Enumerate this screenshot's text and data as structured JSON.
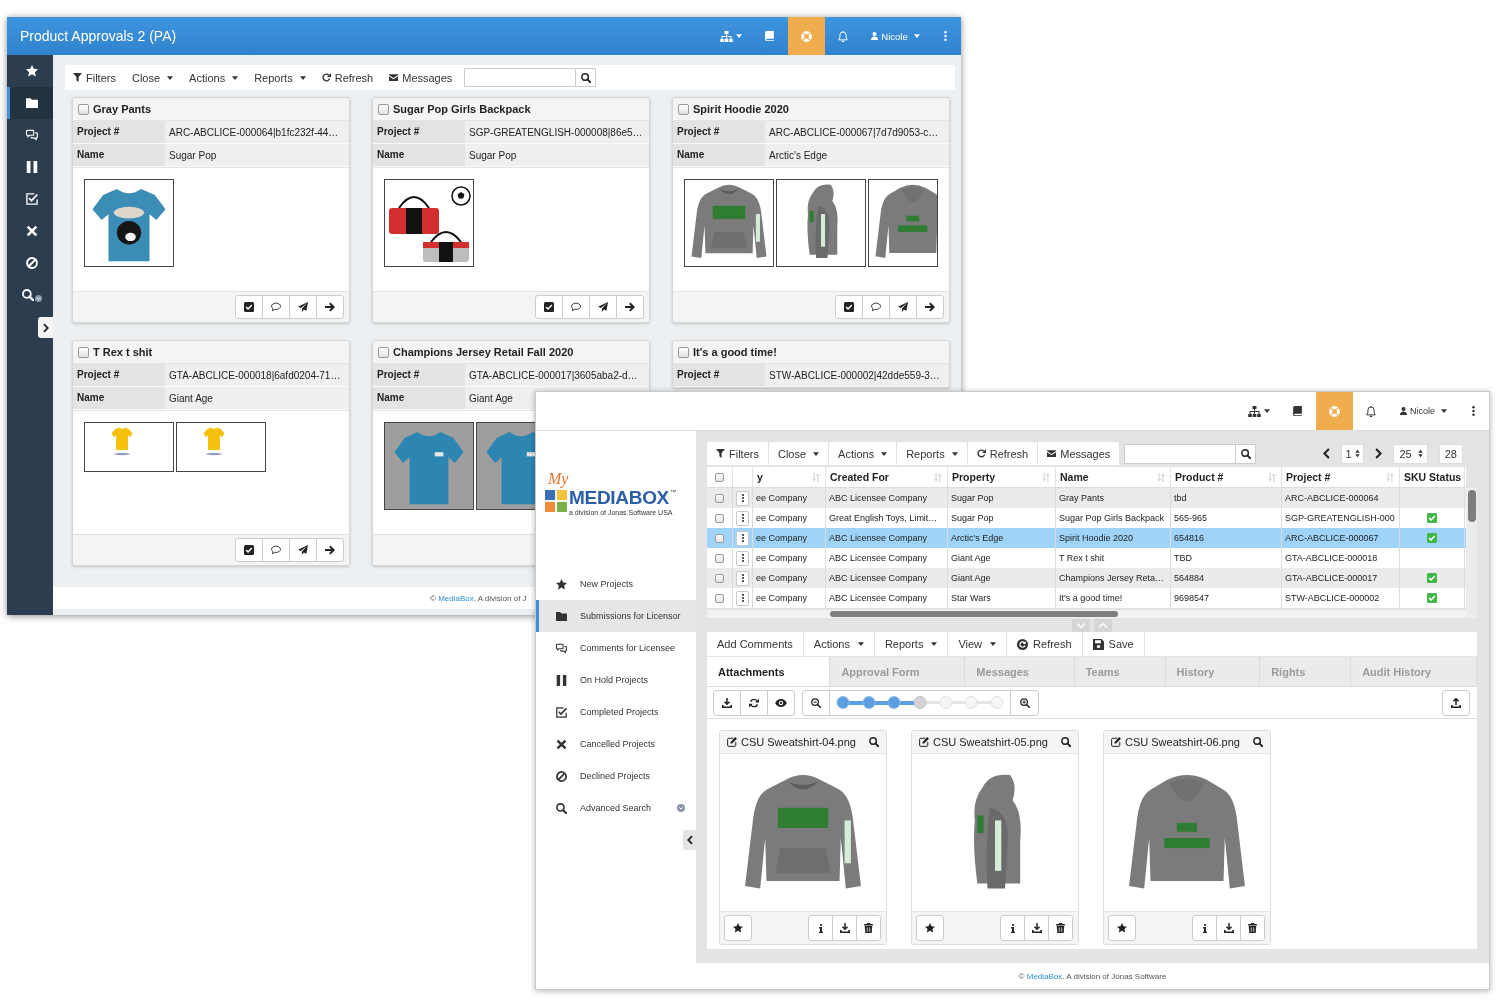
{
  "back_window": {
    "title": "Product Approvals 2 (PA)",
    "user": "Nicole",
    "sidebar": [
      {
        "selected": false
      },
      {
        "selected": true
      },
      {
        "selected": false
      },
      {
        "selected": false
      },
      {
        "selected": false
      },
      {
        "selected": false
      },
      {
        "selected": false
      },
      {
        "selected": false
      }
    ],
    "toolbar": [
      {
        "label": "Filters",
        "kind": "button"
      },
      {
        "label": "Close",
        "kind": "dropdown"
      },
      {
        "label": "Actions",
        "kind": "dropdown"
      },
      {
        "label": "Reports",
        "kind": "dropdown"
      },
      {
        "label": "Refresh",
        "kind": "button"
      },
      {
        "label": "Messages",
        "kind": "button"
      }
    ],
    "cards": [
      {
        "title": "Gray Pants",
        "checked": false,
        "fields": [
          {
            "label": "Project #",
            "value": "ARC-ABCLICE-000064|b1fc232f-44…"
          },
          {
            "label": "Name",
            "value": "Sugar Pop"
          }
        ],
        "images": [
          {
            "kind": "tee-print"
          }
        ],
        "action_buttons": true
      },
      {
        "title": "Sugar Pop Girls Backpack",
        "checked": false,
        "fields": [
          {
            "label": "Project #",
            "value": "SGP-GREATENGLISH-000008|86e5…"
          },
          {
            "label": "Name",
            "value": "Sugar Pop"
          }
        ],
        "images": [
          {
            "kind": "bags"
          }
        ],
        "action_buttons": true
      },
      {
        "title": "Spirit Hoodie 2020",
        "checked": false,
        "fields": [
          {
            "label": "Project #",
            "value": "ARC-ABCLICE-000067|7d7d9053-c…"
          },
          {
            "label": "Name",
            "value": "Arctic's Edge"
          }
        ],
        "images": [
          {
            "kind": "hoodie-front"
          },
          {
            "kind": "hoodie-side"
          },
          {
            "kind": "hoodie-back"
          }
        ],
        "action_buttons": true
      },
      {
        "title": "T Rex t shit",
        "checked": false,
        "fields": [
          {
            "label": "Project #",
            "value": "GTA-ABCLICE-000018|6afd0204-71…"
          },
          {
            "label": "Name",
            "value": "Giant Age"
          }
        ],
        "images": [
          {
            "kind": "tee-small"
          },
          {
            "kind": "tee-small"
          }
        ],
        "action_buttons": true
      },
      {
        "title": "Champions Jersey Retail Fall 2020",
        "checked": false,
        "fields": [
          {
            "label": "Project #",
            "value": "GTA-ABCLICE-000017|3605aba2-d…"
          },
          {
            "label": "Name",
            "value": "Giant Age"
          }
        ],
        "images": [
          {
            "kind": "tee-studio"
          },
          {
            "kind": "tee-studio"
          }
        ]
      },
      {
        "title": "It's a good time!",
        "checked": false,
        "fields": [
          {
            "label": "Project #",
            "value": "STW-ABCLICE-000002|42dde559-3…"
          }
        ]
      }
    ],
    "footer": {
      "prefix": "©",
      "link": "MediaBox",
      "suffix": ". A division of J"
    }
  },
  "front_window": {
    "user": "Nicole",
    "logo": {
      "script": "My",
      "wordmark": "MEDIABOX",
      "trademark": "™",
      "tagline": "a division of Jonas Software USA"
    },
    "nav": [
      {
        "label": "New Projects",
        "selected": false
      },
      {
        "label": "Submissions for Licensor",
        "selected": true
      },
      {
        "label": "Comments for Licensee",
        "selected": false
      },
      {
        "label": "On Hold Projects",
        "selected": false
      },
      {
        "label": "Completed Projects",
        "selected": false
      },
      {
        "label": "Cancelled Projects",
        "selected": false
      },
      {
        "label": "Declined Projects",
        "selected": false
      },
      {
        "label": "Advanced Search",
        "selected": false
      }
    ],
    "toolbar": [
      {
        "label": "Filters",
        "kind": "button"
      },
      {
        "label": "Close",
        "kind": "dropdown"
      },
      {
        "label": "Actions",
        "kind": "dropdown"
      },
      {
        "label": "Reports",
        "kind": "dropdown"
      },
      {
        "label": "Refresh",
        "kind": "button"
      },
      {
        "label": "Messages",
        "kind": "button"
      }
    ],
    "pager": {
      "page": "1",
      "per_page": "25",
      "total": "28"
    },
    "table": {
      "all_checked": false,
      "columns": [
        {
          "label": "y",
          "sortable": true
        },
        {
          "label": "Created For",
          "sortable": true
        },
        {
          "label": "Property",
          "sortable": true
        },
        {
          "label": "Name",
          "sortable": true
        },
        {
          "label": "Product #",
          "sortable": true
        },
        {
          "label": "Project #",
          "sortable": true
        },
        {
          "label": "SKU Status",
          "sortable": false
        }
      ],
      "rows": [
        {
          "selected": false,
          "checked": false,
          "sku_ok": false,
          "cells": [
            "ee Company",
            "ABC Licensee Company",
            "Sugar Pop",
            "Gray Pants",
            "tbd",
            "ARC-ABCLICE-000064"
          ]
        },
        {
          "selected": false,
          "checked": false,
          "sku_ok": true,
          "cells": [
            "ee Company",
            "Great English Toys, Limit…",
            "Sugar Pop",
            "Sugar Pop Girls Backpack",
            "565-965",
            "SGP-GREATENGLISH-000"
          ]
        },
        {
          "selected": true,
          "checked": false,
          "sku_ok": true,
          "cells": [
            "ee Company",
            "ABC Licensee Company",
            "Arctic's Edge",
            "Spirit Hoodie 2020",
            "654816",
            "ARC-ABCLICE-000067"
          ]
        },
        {
          "selected": false,
          "checked": false,
          "sku_ok": false,
          "cells": [
            "ee Company",
            "ABC Licensee Company",
            "Giant Age",
            "T Rex t shit",
            "TBD",
            "GTA-ABCLICE-000018"
          ]
        },
        {
          "selected": false,
          "checked": false,
          "sku_ok": true,
          "cells": [
            "ee Company",
            "ABC Licensee Company",
            "Giant Age",
            "Champions Jersey Reta…",
            "564884",
            "GTA-ABCLICE-000017"
          ]
        },
        {
          "selected": false,
          "checked": false,
          "sku_ok": true,
          "cells": [
            "ee Company",
            "ABC Licensee Company",
            "Star Wars",
            "It's a good time!",
            "9698547",
            "STW-ABCLICE-000002"
          ]
        }
      ]
    },
    "detail_toolbar": [
      {
        "label": "Add Comments",
        "kind": "button"
      },
      {
        "label": "Actions",
        "kind": "dropdown"
      },
      {
        "label": "Reports",
        "kind": "dropdown"
      },
      {
        "label": "View",
        "kind": "dropdown"
      },
      {
        "label": "Refresh",
        "kind": "button"
      },
      {
        "label": "Save",
        "kind": "button"
      }
    ],
    "tabs": [
      {
        "label": "Attachments",
        "selected": true
      },
      {
        "label": "Approval Form",
        "selected": false
      },
      {
        "label": "Messages",
        "selected": false
      },
      {
        "label": "Teams",
        "selected": false
      },
      {
        "label": "History",
        "selected": false
      },
      {
        "label": "Rights",
        "selected": false
      },
      {
        "label": "Audit History",
        "selected": false
      }
    ],
    "zoom_slider": {
      "level": 0.5
    },
    "attachments": [
      {
        "filename": "CSU Sweatshirt-04.png",
        "kind": "hoodie-front"
      },
      {
        "filename": "CSU Sweatshirt-05.png",
        "kind": "hoodie-side"
      },
      {
        "filename": "CSU Sweatshirt-06.png",
        "kind": "hoodie-back"
      }
    ],
    "footer": {
      "prefix": "©",
      "link": "MediaBox",
      "suffix": ". A division of Jonas Software"
    }
  }
}
